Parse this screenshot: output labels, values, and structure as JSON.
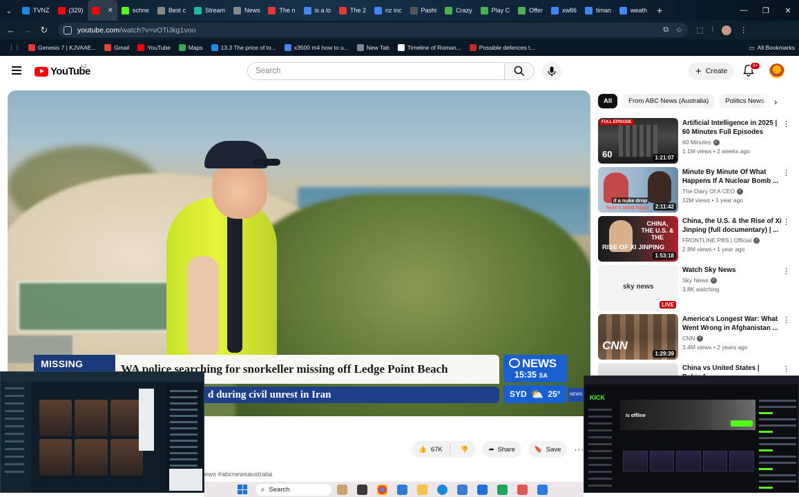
{
  "browser": {
    "tabs": [
      {
        "label": "TVNZ",
        "color": "#1e88e5",
        "active": false
      },
      {
        "label": "(329)",
        "color": "#ff0000",
        "active": false
      },
      {
        "label": "",
        "color": "#ff0000",
        "active": true
      },
      {
        "label": "schne",
        "color": "#53fc18",
        "active": false
      },
      {
        "label": "Best c",
        "color": "#888888",
        "active": false
      },
      {
        "label": "Stream",
        "color": "#1abc9c",
        "active": false
      },
      {
        "label": "News",
        "color": "#888888",
        "active": false
      },
      {
        "label": "The n",
        "color": "#e53935",
        "active": false
      },
      {
        "label": "is a lo",
        "color": "#4285f4",
        "active": false
      },
      {
        "label": "The 2",
        "color": "#e53935",
        "active": false
      },
      {
        "label": "nz inc",
        "color": "#4285f4",
        "active": false
      },
      {
        "label": "Pashi",
        "color": "#555555",
        "active": false
      },
      {
        "label": "Crazy",
        "color": "#4caf50",
        "active": false
      },
      {
        "label": "Play C",
        "color": "#4caf50",
        "active": false
      },
      {
        "label": "Offer",
        "color": "#4caf50",
        "active": false
      },
      {
        "label": "xw86",
        "color": "#4285f4",
        "active": false
      },
      {
        "label": "timan",
        "color": "#4285f4",
        "active": false
      },
      {
        "label": "weath",
        "color": "#4285f4",
        "active": false
      }
    ],
    "url_host": "youtube.com",
    "url_path": "/watch?v=vOTiJkg1voo",
    "bookmarks": [
      {
        "label": "Genesis 7 | KJVAAE...",
        "color": "#e53935"
      },
      {
        "label": "Gmail",
        "color": "#ea4335"
      },
      {
        "label": "YouTube",
        "color": "#ff0000"
      },
      {
        "label": "Maps",
        "color": "#34a853"
      },
      {
        "label": "13.3 The price of to...",
        "color": "#1e88e5"
      },
      {
        "label": "x3500 m4 how to u...",
        "color": "#4285f4"
      },
      {
        "label": "New Tab",
        "color": "#7b8794"
      },
      {
        "label": "Timeline of Roman...",
        "color": "#ffffff"
      },
      {
        "label": "Possible defences t...",
        "color": "#c62828"
      }
    ],
    "all_bookmarks_label": "All Bookmarks"
  },
  "youtube": {
    "logo_text": "YouTube",
    "region": "NZ",
    "search_placeholder": "Search",
    "create_label": "Create",
    "notification_count": "9+"
  },
  "video": {
    "missing_tag": "MISSING",
    "headline": "WA police searching for snorkeller missing off Ledge Point Beach",
    "ticker": "d during civil unrest in Iran",
    "abc_brand": "NEWS",
    "abc_time": "15:35",
    "abc_tz": "SA",
    "abc_city": "SYD",
    "abc_temp": "25°",
    "abc_corner": "NEWS",
    "hashtags": "ews #abcnewsaustralia"
  },
  "actions": {
    "like_count": "67K",
    "share_label": "Share",
    "save_label": "Save"
  },
  "chips": [
    {
      "label": "All",
      "active": true
    },
    {
      "label": "From ABC News (Australia)",
      "active": false
    },
    {
      "label": "Politics News",
      "active": false
    }
  ],
  "recommendations": [
    {
      "title": "Artificial Intelligence in 2025 | 60 Minutes Full Episodes",
      "channel": "60 Minutes",
      "verified": true,
      "stats": "1.1M views • 2 weeks ago",
      "duration": "1:21:07",
      "live": false
    },
    {
      "title": "Minute By Minute Of What Happens If A Nuclear Bomb ...",
      "channel": "The Diary Of A CEO",
      "verified": true,
      "stats": "12M views • 1 year ago",
      "duration": "2:11:42",
      "live": false
    },
    {
      "title": "China, the U.S. & the Rise of Xi Jinping (full documentary) | ...",
      "channel": "FRONTLINE PBS | Official",
      "verified": true,
      "stats": "2.8M views • 1 year ago",
      "duration": "1:53:18",
      "live": false
    },
    {
      "title": "Watch Sky News",
      "channel": "Sky News",
      "verified": true,
      "stats": "3.8K watching",
      "duration": "LIVE",
      "live": true
    },
    {
      "title": "America's Longest War: What Went Wrong in Afghanistan ...",
      "channel": "CNN",
      "verified": true,
      "stats": "3.4M views • 2 years ago",
      "duration": "1:29:39",
      "live": false
    },
    {
      "title": "China vs United States | Behind",
      "channel": "",
      "verified": false,
      "stats": "",
      "duration": "",
      "live": false
    }
  ],
  "thumb_text": {
    "full_episode": "FULL EPISODE",
    "sixty": "60",
    "nuke_caption": "if a nuke drop",
    "nuke_caption2": "here's what happ",
    "china_caption": "CHINA, THE U.S. & THE",
    "xi_caption": "RISE OF XI JINPING",
    "sky_logo": "sky news",
    "cnn_logo": "CNN"
  },
  "overlay_right": {
    "brand": "KICK",
    "offline_text": "is offline"
  },
  "taskbar": {
    "search_label": "Search"
  }
}
